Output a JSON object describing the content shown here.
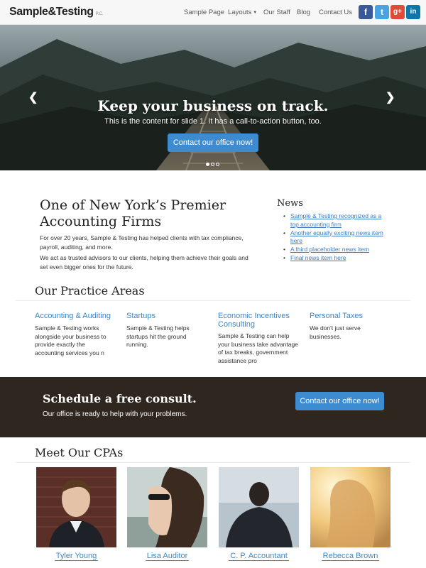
{
  "header": {
    "logo": "Sample&Testing",
    "logo_suffix": "P.C.",
    "nav": [
      "Sample Page",
      "Layouts",
      "Our Staff",
      "Blog",
      "Contact Us"
    ],
    "social_icons": [
      "facebook-icon",
      "twitter-icon",
      "google-plus-icon",
      "linkedin-icon"
    ],
    "social_glyphs": [
      "f",
      "t",
      "g+",
      "in"
    ],
    "social_colors": [
      "#3b5998",
      "#4aa3df",
      "#dd4b39",
      "#0e76a8"
    ]
  },
  "hero": {
    "title": "Keep your business on track.",
    "text": "This is the content for slide 1. It has a call-to-action button, too.",
    "button": "Contact our office now!",
    "slides": 3,
    "active_slide": 1
  },
  "intro": {
    "title": "One of New York’s Premier Accounting Firms",
    "p1": "For over 20 years, Sample & Testing has helped clients with tax compliance, payroll, auditing, and more.",
    "p2": "We act as trusted advisors to our clients, helping them achieve their goals and set even bigger ones for the future."
  },
  "news": {
    "title": "News",
    "items": [
      "Sample & Testing recognized as a top accounting firm",
      "Another equally exciting news item here",
      "A third placeholder news item",
      "Final news item here"
    ]
  },
  "practice": {
    "title": "Our Practice Areas",
    "areas": [
      {
        "title": "Accounting & Auditing",
        "text": "Sample & Testing works alongside your business to provide exactly the accounting services you n"
      },
      {
        "title": "Startups",
        "text": "Sample & Testing helps startups hit the ground running."
      },
      {
        "title": "Economic Incentives Consulting",
        "text": "Sample & Testing can help your business take advantage of tax breaks, government assistance pro"
      },
      {
        "title": "Personal Taxes",
        "text": "We don't just serve businesses."
      }
    ]
  },
  "consult": {
    "title": "Schedule a free consult.",
    "text": "Our office is ready to help with your problems.",
    "button": "Contact our office now!"
  },
  "cpas": {
    "title": "Meet Our CPAs",
    "people": [
      {
        "name": "Tyler Young"
      },
      {
        "name": "Lisa Auditor"
      },
      {
        "name": "C. P. Accountant"
      },
      {
        "name": "Rebecca Brown"
      }
    ]
  }
}
